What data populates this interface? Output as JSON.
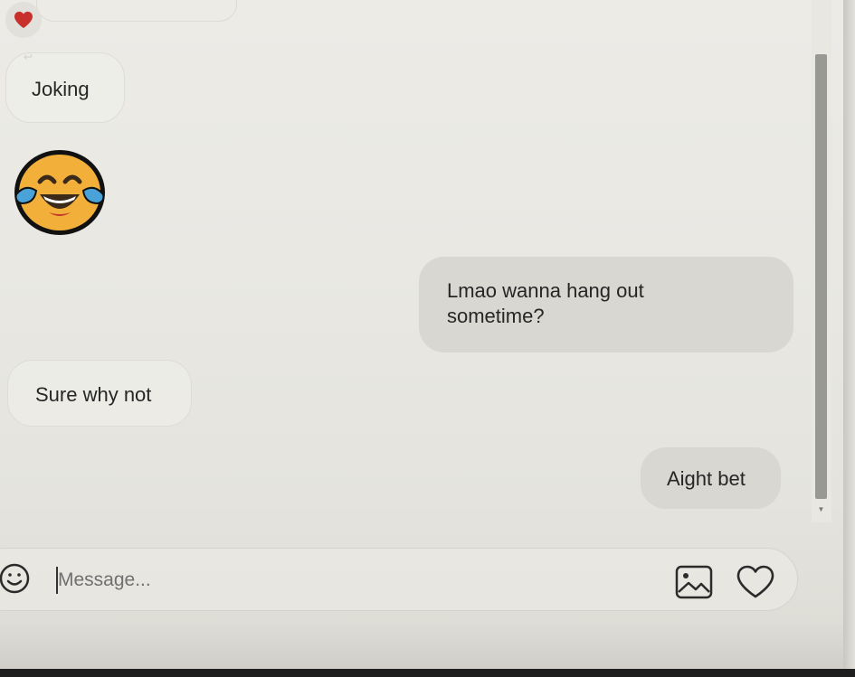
{
  "messages": [
    {
      "side": "incoming",
      "text": "Joking"
    },
    {
      "side": "incoming",
      "emoji": "face-with-tears-of-joy"
    },
    {
      "side": "outgoing",
      "line1": "Lmao wanna hang out",
      "line2": "sometime?"
    },
    {
      "side": "incoming",
      "text": "Sure why not"
    },
    {
      "side": "outgoing",
      "text": "Aight bet"
    }
  ],
  "reaction": {
    "icon": "heart-icon",
    "color": "#c8302c"
  },
  "composer": {
    "placeholder": "Message...",
    "emoji_icon": "smiley-icon",
    "image_icon": "image-icon",
    "like_icon": "heart-outline-icon"
  },
  "colors": {
    "incoming_border": "#dddcd5",
    "outgoing_bubble": "#d8d7d1",
    "background": "#ecebe6",
    "scrollbar_thumb": "#999993"
  }
}
